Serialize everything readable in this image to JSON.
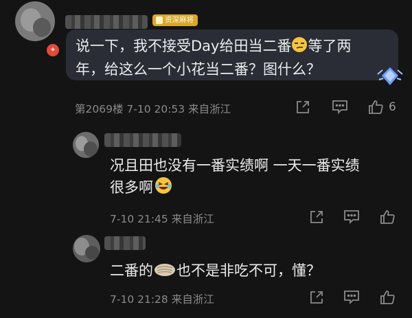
{
  "comments": [
    {
      "badge": "资深麻将",
      "text_line1": "说一下，我不接受Day给田当二番",
      "text_line1_after": "等了两",
      "text_line2": "年，给这么一个小花当二番？图什么？",
      "meta": "第2069楼 7-10 20:53 来自浙江",
      "likes": "6"
    },
    {
      "text_line1": "况且田也没有一番实绩啊 一天一番实绩",
      "text_line2": "很多啊",
      "meta": "7-10 21:45 来自浙江"
    },
    {
      "text_before": "二番的",
      "text_after": "也不是非吃不可，懂？",
      "meta": "7-10 21:28 来自浙江"
    }
  ],
  "icons": [
    "share-icon",
    "comment-icon",
    "like-icon",
    "diamond-badge-icon",
    "emoji-smirk-icon",
    "emoji-laugh-icon",
    "emoji-pie-icon"
  ],
  "colors": {
    "background": "#141414",
    "bubble": "#2a2d36",
    "badge": "#d8a82e",
    "meta": "#8a8a8a"
  }
}
